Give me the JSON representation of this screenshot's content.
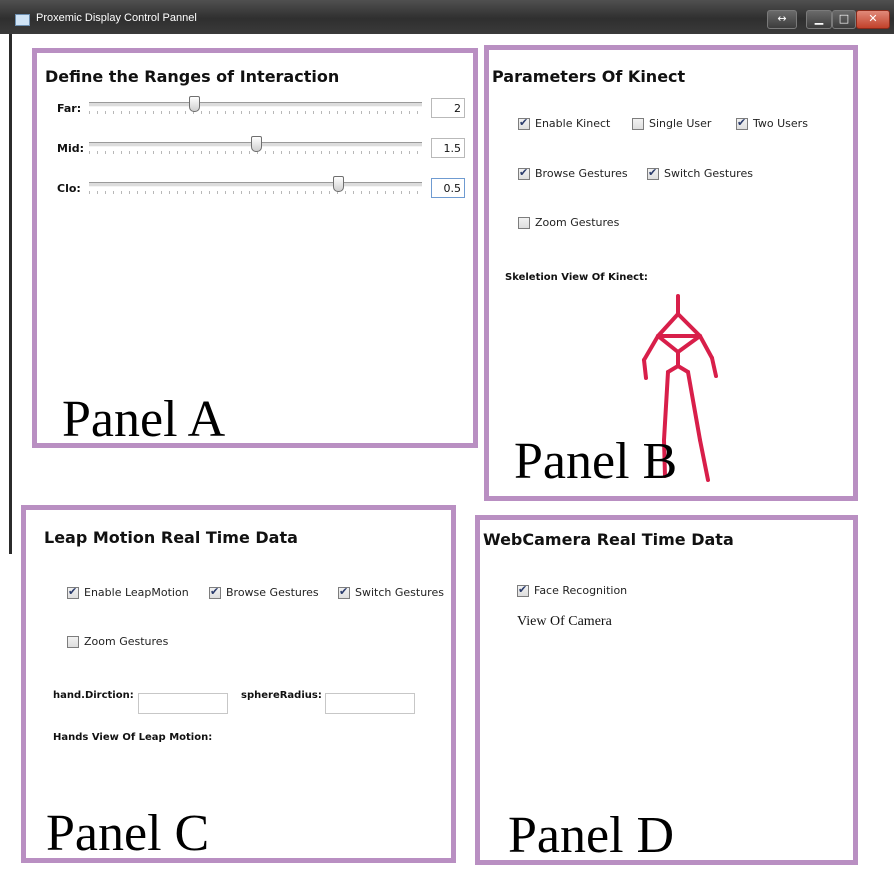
{
  "window": {
    "title": "Proxemic Display Control Pannel"
  },
  "panel_a": {
    "title": "Define the Ranges of Interaction",
    "label": "Panel A",
    "sliders": [
      {
        "label": "Far:",
        "value": "2"
      },
      {
        "label": "Mid:",
        "value": "1.5"
      },
      {
        "label": "Clo:",
        "value": "0.5"
      }
    ]
  },
  "panel_b": {
    "title": "Parameters Of Kinect",
    "label": "Panel B",
    "checkboxes": [
      {
        "label": "Enable Kinect",
        "checked": true
      },
      {
        "label": "Single User",
        "checked": false
      },
      {
        "label": "Two Users",
        "checked": true
      },
      {
        "label": "Browse Gestures",
        "checked": true
      },
      {
        "label": "Switch Gestures",
        "checked": true
      },
      {
        "label": "Zoom Gestures",
        "checked": false
      }
    ],
    "skeleton_label": "Skeletion View Of Kinect:",
    "skeleton_color": "#d81f4a"
  },
  "panel_c": {
    "title": "Leap Motion Real Time Data",
    "label": "Panel C",
    "checkboxes": [
      {
        "label": "Enable LeapMotion",
        "checked": true
      },
      {
        "label": "Browse Gestures",
        "checked": true
      },
      {
        "label": "Switch Gestures",
        "checked": true
      },
      {
        "label": "Zoom Gestures",
        "checked": false
      }
    ],
    "hand_direction_label": "hand.Dirction:",
    "sphere_radius_label": "sphereRadius:",
    "hands_view_label": "Hands View Of Leap Motion:"
  },
  "panel_d": {
    "title": "WebCamera Real Time Data",
    "label": "Panel D",
    "checkboxes": [
      {
        "label": "Face Recognition",
        "checked": true
      }
    ],
    "camera_label": "View Of Camera"
  },
  "colors": {
    "panel_border": "#b98fc2"
  }
}
